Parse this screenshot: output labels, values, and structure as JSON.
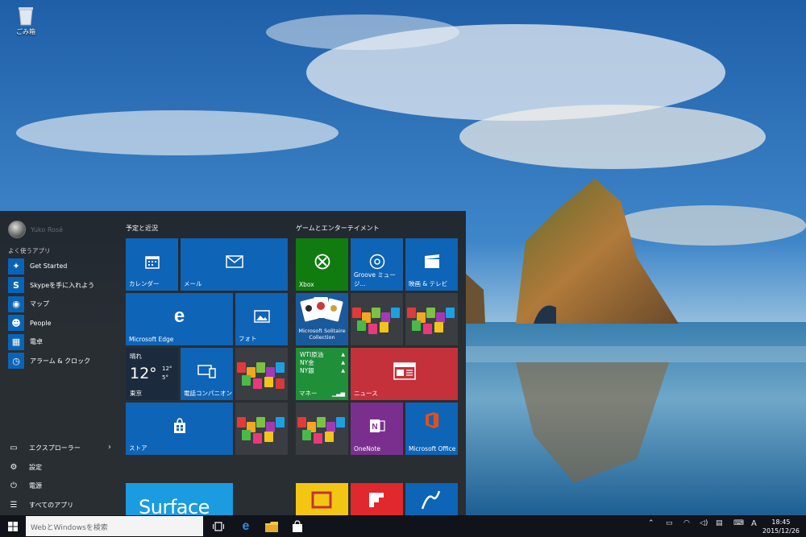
{
  "desktop": {
    "recycle_bin_label": "ごみ箱"
  },
  "start_menu": {
    "user_name": "Yuko Rosé",
    "most_used_label": "よく使うアプリ",
    "apps": [
      {
        "label": "Get Started",
        "icon": "lightbulb-icon"
      },
      {
        "label": "Skypeを手に入れよう",
        "icon": "skype-icon"
      },
      {
        "label": "マップ",
        "icon": "map-icon"
      },
      {
        "label": "People",
        "icon": "people-icon"
      },
      {
        "label": "電卓",
        "icon": "calculator-icon"
      },
      {
        "label": "アラーム & クロック",
        "icon": "alarm-icon"
      }
    ],
    "bottom": {
      "explorer": "エクスプローラー",
      "settings": "設定",
      "power": "電源",
      "all_apps": "すべてのアプリ"
    },
    "groups": {
      "recent": "予定と近況",
      "games": "ゲームとエンターテイメント"
    },
    "tiles": {
      "calendar": "カレンダー",
      "mail": "メール",
      "edge": "Microsoft Edge",
      "photos": "フォト",
      "weather": {
        "condition": "晴れ",
        "temp": "12°",
        "high": "12°",
        "low": "5°",
        "city": "東京"
      },
      "phone": "電話コンパニオン",
      "store": "ストア",
      "xbox": "Xbox",
      "groove": "Groove ミュージ...",
      "movies": "映画 & テレビ",
      "solitaire": "Microsoft Solitaire Collection",
      "money": {
        "lines": [
          "WTI原油",
          "NY金",
          "NY銀"
        ],
        "label": "マネー"
      },
      "news": "ニュース",
      "onenote": "OneNote",
      "office": "Microsoft Office",
      "surface": "Surface"
    }
  },
  "taskbar": {
    "search_placeholder": "WebとWindowsを検索",
    "ime": "A",
    "time": "18:45",
    "date": "2015/12/26"
  }
}
